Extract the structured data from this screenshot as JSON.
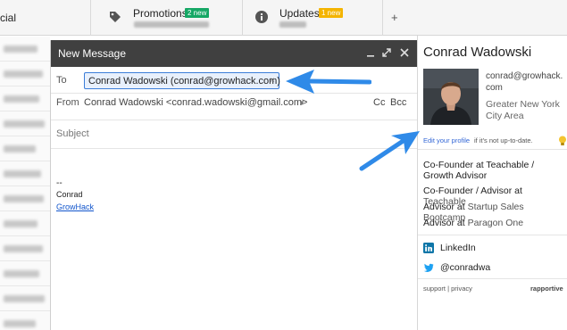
{
  "tabs": {
    "social_fragment": "cial",
    "promotions": {
      "label": "Promotions",
      "badge": "2 new"
    },
    "updates": {
      "label": "Updates",
      "badge": "1 new"
    },
    "add_symbol": "+"
  },
  "compose": {
    "title": "New Message",
    "to_label": "To",
    "recipient": "Conrad Wadowski (conrad@growhack.com)",
    "remove_symbol": "×",
    "from_label": "From",
    "from_value": "Conrad Wadowski <conrad.wadowski@gmail.com>",
    "cc_label": "Cc",
    "bcc_label": "Bcc",
    "subject_placeholder": "Subject",
    "signature": {
      "dash": "--",
      "name": "Conrad",
      "link": "GrowHack"
    }
  },
  "profile": {
    "name": "Conrad Wadowski",
    "email_line1": "conrad@growhack.",
    "email_line2": "com",
    "location_line1": "Greater New York",
    "location_line2": "City Area",
    "edit_link": "Edit your profile",
    "edit_rest": "if it's not up-to-date.",
    "jobs": [
      {
        "role": "Co-Founder at Teachable / Growth Advisor",
        "company": ""
      },
      {
        "role": "Co-Founder / Advisor at",
        "company": "Teachable"
      },
      {
        "role": "Advisor at",
        "company": "Startup Sales Bootcamp"
      },
      {
        "role": "Advisor at",
        "company": "Paragon One"
      }
    ],
    "links": [
      {
        "icon": "linkedin-icon",
        "label": "LinkedIn"
      },
      {
        "icon": "twitter-icon",
        "label": "@conradwa"
      }
    ],
    "footer": "support | privacy",
    "footer_brand": "rapportive"
  },
  "colors": {
    "compose_header": "#404040",
    "chip_border": "#3b7dd8",
    "arrow": "#2f8ae8",
    "badge_green": "#16a765",
    "badge_yellow": "#f4b400",
    "link": "#3367d6"
  }
}
